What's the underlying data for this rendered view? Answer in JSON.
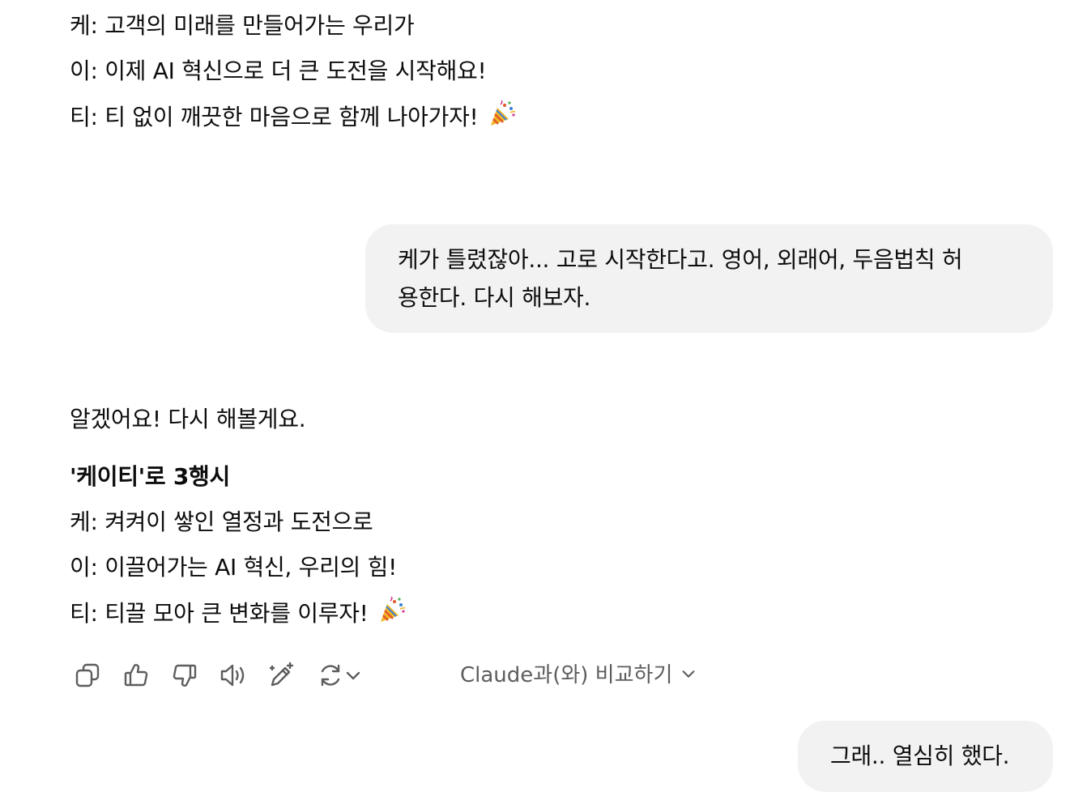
{
  "assistant_prev": {
    "lines": [
      "케: 고객의 미래를 만들어가는 우리가",
      "이: 이제 AI 혁신으로 더 큰 도전을 시작해요!",
      "티: 티 없이 깨끗한 마음으로 함께 나아가자!"
    ]
  },
  "user_message_1": {
    "line1": "케가 틀렸잖아... 고로 시작한다고. 영어, 외래어, 두음법칙 허",
    "line2": "용한다. 다시 해보자."
  },
  "assistant_reply": {
    "intro": "알겠어요! 다시 해볼게요.",
    "heading": "'케이티'로 3행시",
    "lines": [
      "케: 켜켜이 쌓인 열정과 도전으로",
      "이: 이끌어가는 AI 혁신, 우리의 힘!",
      "티: 티끌 모아 큰 변화를 이루자!"
    ]
  },
  "toolbar": {
    "icons": [
      "copy-icon",
      "thumbs-up-icon",
      "thumbs-down-icon",
      "read-aloud-icon",
      "edit-sparkle-icon",
      "regenerate-icon",
      "chevron-down-icon"
    ],
    "compare_label": "Claude과(와) 비교하기"
  },
  "user_message_2": {
    "text": "그래.. 열심히 했다."
  },
  "emoji": "party-popper-icon"
}
